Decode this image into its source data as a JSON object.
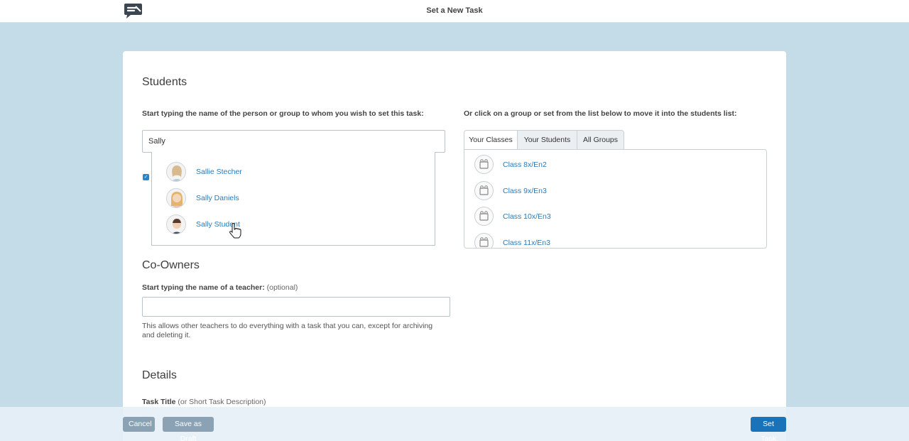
{
  "header": {
    "title": "Set a New Task",
    "logo_icon": "speech-bubble-logo-icon"
  },
  "students": {
    "heading": "Students",
    "prompt": "Start typing the name of the person or group to whom you wish to set this task:",
    "search_value": "Sally",
    "suggestions": [
      {
        "name": "Sallie Stecher"
      },
      {
        "name": "Sally Daniels"
      },
      {
        "name": "Sally Student"
      }
    ]
  },
  "groups": {
    "prompt": "Or click on a group or set from the list below to move it into the students list:",
    "tabs": [
      {
        "label": "Your Classes"
      },
      {
        "label": "Your Students"
      },
      {
        "label": "All Groups"
      }
    ],
    "classes": [
      {
        "name": "Class 8x/En2"
      },
      {
        "name": "Class 9x/En3"
      },
      {
        "name": "Class 10x/En3"
      },
      {
        "name": "Class 11x/En3"
      }
    ]
  },
  "coowners": {
    "heading": "Co-Owners",
    "prompt_bold": "Start typing the name of a teacher:",
    "prompt_optional": "(optional)",
    "help": "This allows other teachers to do everything with a task that you can, except for archiving and deleting it."
  },
  "details": {
    "heading": "Details",
    "title_label_bold": "Task Title",
    "title_label_note": "(or Short Task Description)"
  },
  "footer": {
    "cancel_label": "Cancel",
    "draft_label": "Save as Draft",
    "set_label": "Set Task"
  },
  "colors": {
    "accent": "#1a73b8",
    "link": "#2a7ab8",
    "background": "#c4dbe8"
  }
}
